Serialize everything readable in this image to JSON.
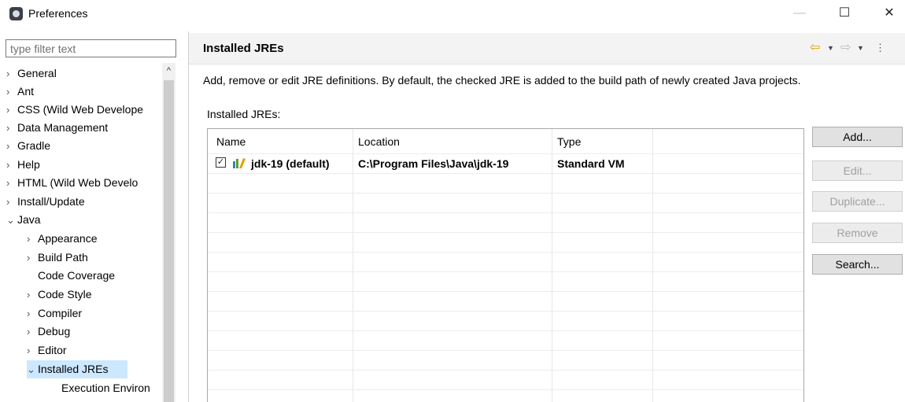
{
  "window": {
    "title": "Preferences",
    "minimize_icon": "—",
    "maximize_icon": "☐",
    "close_icon": "✕"
  },
  "filter": {
    "placeholder": "type filter text"
  },
  "tree": {
    "items": [
      {
        "label": "General",
        "chevron": "›"
      },
      {
        "label": "Ant",
        "chevron": "›"
      },
      {
        "label": "CSS (Wild Web Develope",
        "chevron": "›"
      },
      {
        "label": "Data Management",
        "chevron": "›"
      },
      {
        "label": "Gradle",
        "chevron": "›"
      },
      {
        "label": "Help",
        "chevron": "›"
      },
      {
        "label": "HTML (Wild Web Develo",
        "chevron": "›"
      },
      {
        "label": "Install/Update",
        "chevron": "›"
      },
      {
        "label": "Java",
        "chevron": "⌄"
      },
      {
        "label": "Appearance",
        "chevron": "›"
      },
      {
        "label": "Build Path",
        "chevron": "›"
      },
      {
        "label": "Code Coverage",
        "chevron": ""
      },
      {
        "label": "Code Style",
        "chevron": "›"
      },
      {
        "label": "Compiler",
        "chevron": "›"
      },
      {
        "label": "Debug",
        "chevron": "›"
      },
      {
        "label": "Editor",
        "chevron": "›"
      },
      {
        "label": "Installed JREs",
        "chevron": "⌄"
      },
      {
        "label": "Execution Environ",
        "chevron": ""
      }
    ],
    "selected_label": "Installed JREs",
    "scroll_up_icon": "^"
  },
  "page": {
    "title": "Installed JREs",
    "description": "Add, remove or edit JRE definitions. By default, the checked JRE is added to the build path of newly created Java projects.",
    "section_label": "Installed JREs:",
    "nav_back_icon": "⇦",
    "nav_fwd_icon": "⇨",
    "nav_dropdown_icon": "▼",
    "nav_menu_icon": "⋮"
  },
  "table": {
    "columns": [
      "Name",
      "Location",
      "Type"
    ],
    "rows": [
      {
        "checked": true,
        "check_glyph": "✓",
        "name": "jdk-19 (default)",
        "location": "C:\\Program Files\\Java\\jdk-19",
        "type": "Standard VM"
      }
    ]
  },
  "buttons": {
    "add": "Add...",
    "edit": "Edit...",
    "duplicate": "Duplicate...",
    "remove": "Remove",
    "search": "Search..."
  },
  "colors": {
    "selection": "#cce8ff",
    "back_arrow": "#e2a200",
    "disabled_text": "#a0a0a0"
  }
}
